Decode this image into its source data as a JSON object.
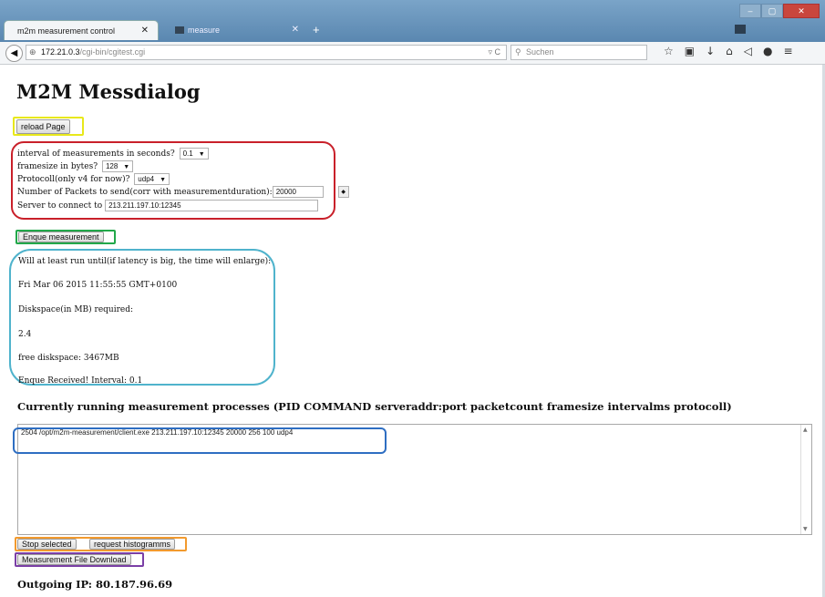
{
  "browser": {
    "tabs": [
      {
        "label": "m2m measurement control",
        "active": true
      },
      {
        "label": "measure",
        "active": false
      }
    ],
    "url_host": "172.21.0.3",
    "url_path": "/cgi-bin/cgitest.cgi",
    "search_placeholder": "Suchen"
  },
  "page": {
    "title": "M2M Messdialog",
    "reload_button": "reload Page",
    "form": {
      "interval_label": "interval of measurements in seconds?",
      "interval_value": "0.1",
      "framesize_label": "framesize in bytes?",
      "framesize_value": "128",
      "protocol_label": "Protocoll(only v4 for now)?",
      "protocol_value": "udp4",
      "packets_label": "Number of Packets to send(corr with measurementduration):",
      "packets_value": "20000",
      "server_label": "Server to connect to",
      "server_value": "213.211.197.10:12345"
    },
    "enqueue_button": "Enque measurement",
    "info": {
      "line1": "Will at least run until(if latency is big, the time will enlarge):",
      "line2": "Fri Mar 06 2015 11:55:55 GMT+0100",
      "line3": "Diskspace(in MB) required:",
      "line4": "2.4",
      "line5": "free diskspace: 3467MB",
      "line6": "Enque Received! Interval: 0.1"
    },
    "processes_heading": "Currently running measurement processes (PID COMMAND serveraddr:port packetcount framesize intervalms protocoll)",
    "process_items": [
      "2504 /opt/m2m-measurement/client.exe 213.211.197.10:12345 20000 256 100 udp4"
    ],
    "stop_button": "Stop selected",
    "histograms_button": "request histogramms",
    "download_button": "Measurement File Download",
    "outgoing_ip": "Outgoing IP: 80.187.96.69"
  },
  "colors": {
    "highlight_yellow": "#e8e81a",
    "highlight_red": "#c9202a",
    "highlight_green": "#22a84a",
    "highlight_cyan": "#4fb3cc",
    "highlight_blue": "#2e6ec2",
    "highlight_orange": "#f29a2e",
    "highlight_purple": "#7b3fa6"
  }
}
